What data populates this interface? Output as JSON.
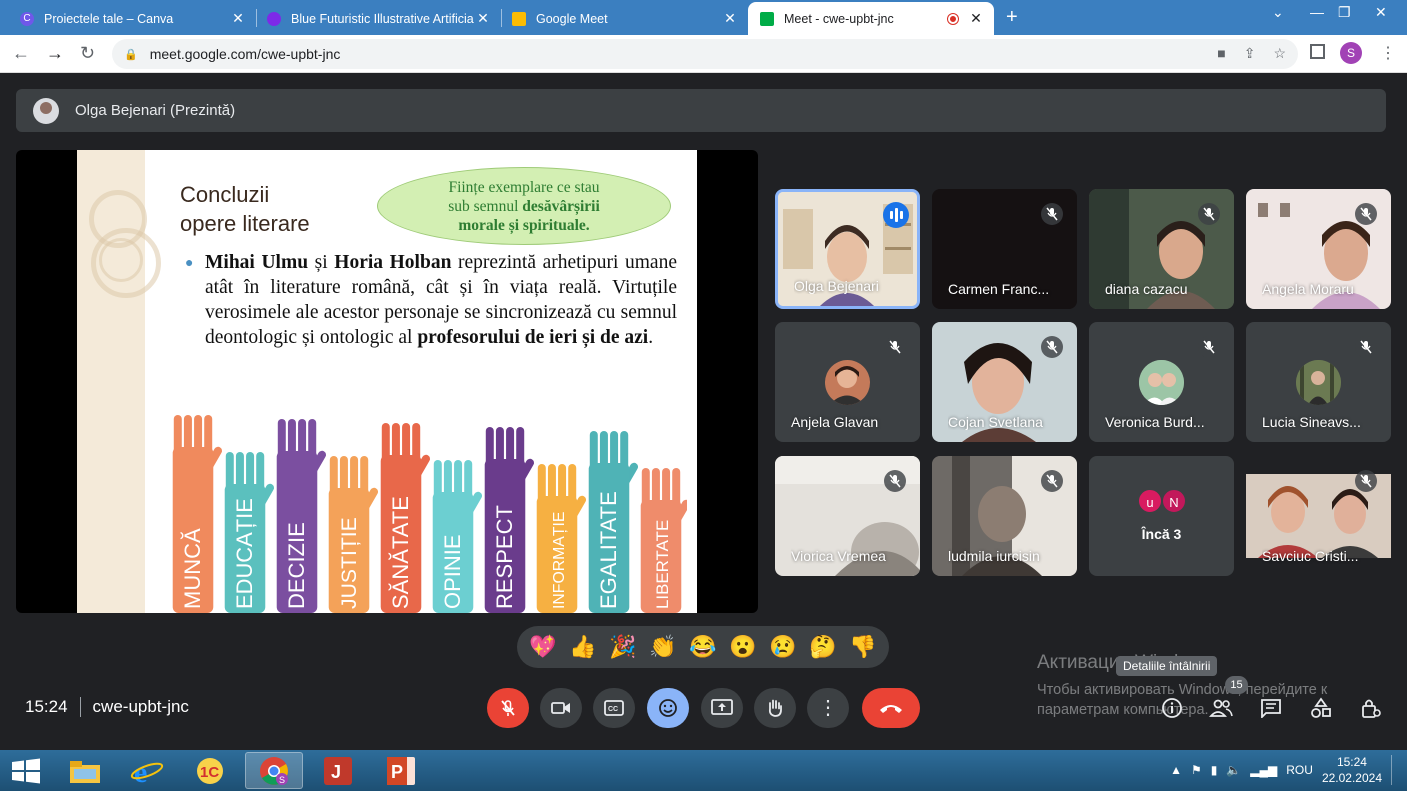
{
  "browser": {
    "tabs": [
      {
        "title": "Proiectele tale – Canva",
        "icon": "canva-icon",
        "color": "#6f58e9"
      },
      {
        "title": "Blue Futuristic Illustrative Artificia",
        "icon": "canva-icon",
        "color": "#7d2ae8"
      },
      {
        "title": "Google Meet",
        "icon": "meet-icon",
        "color": "#00ac47"
      },
      {
        "title": "Meet - cwe-upbt-jnc",
        "icon": "meet-icon",
        "color": "#00ac47",
        "active": true
      }
    ],
    "url": "meet.google.com/cwe-upbt-jnc",
    "profile_initial": "S",
    "profile_color": "#a142b5"
  },
  "presenter": {
    "label": "Olga Bejenari (Prezintă)"
  },
  "slide": {
    "title_line1": "Concluzii",
    "title_line2": "opere literare",
    "bubble_line1": "Ființe exemplare ce stau",
    "bubble_line2_pre": "sub semnul ",
    "bubble_line2_bold": "desăvârșirii",
    "bubble_line3": "morale și spirituale.",
    "text_b1": "Mihai Ulmu",
    "text_t1": " și ",
    "text_b2": "Horia Holban",
    "text_t2": " reprezintă arhetipuri umane atât în literature română, cât și în viața reală. Virtuțile verosimele ale acestor personaje se sincronizează cu semnul deontologic și ontologic al ",
    "text_b3": "profesorului de ieri și de azi",
    "text_t3": ".",
    "hand_words": [
      "MUNCĂ",
      "EDUCAȚIE",
      "DECIZIE",
      "JUSTIȚIE",
      "SĂNĂTATE",
      "OPINIE",
      "RESPECT",
      "INFORMAȚIE",
      "EGALITATE",
      "LIBERTATE"
    ]
  },
  "participants": [
    {
      "name": "Olga Bejenari",
      "speaking": true
    },
    {
      "name": "Carmen Franc..."
    },
    {
      "name": "diana cazacu"
    },
    {
      "name": "Angela Moraru"
    },
    {
      "name": "Anjela Glavan"
    },
    {
      "name": "Cojan Svetlana"
    },
    {
      "name": "Veronica Burd..."
    },
    {
      "name": "Lucia Sineavs..."
    },
    {
      "name": "Viorica Vremea"
    },
    {
      "name": "ludmila iurcisin"
    },
    {
      "name": "Încă 3",
      "bubbles": [
        "u",
        "N"
      ]
    },
    {
      "name": "Savciuc Cristi..."
    }
  ],
  "reactions": [
    "💖",
    "👍",
    "🎉",
    "👏",
    "😂",
    "😮",
    "😢",
    "🤔",
    "👎"
  ],
  "meeting": {
    "time": "15:24",
    "code": "cwe-upbt-jnc",
    "people_count": "15",
    "tooltip": "Detaliile întâlnirii"
  },
  "watermark": {
    "line1": "Активация Windows",
    "line2": "Чтобы активировать Windows, перейдите к",
    "line3": "параметрам компьютера."
  },
  "taskbar": {
    "lang": "ROU",
    "time": "15:24",
    "date": "22.02.2024"
  }
}
